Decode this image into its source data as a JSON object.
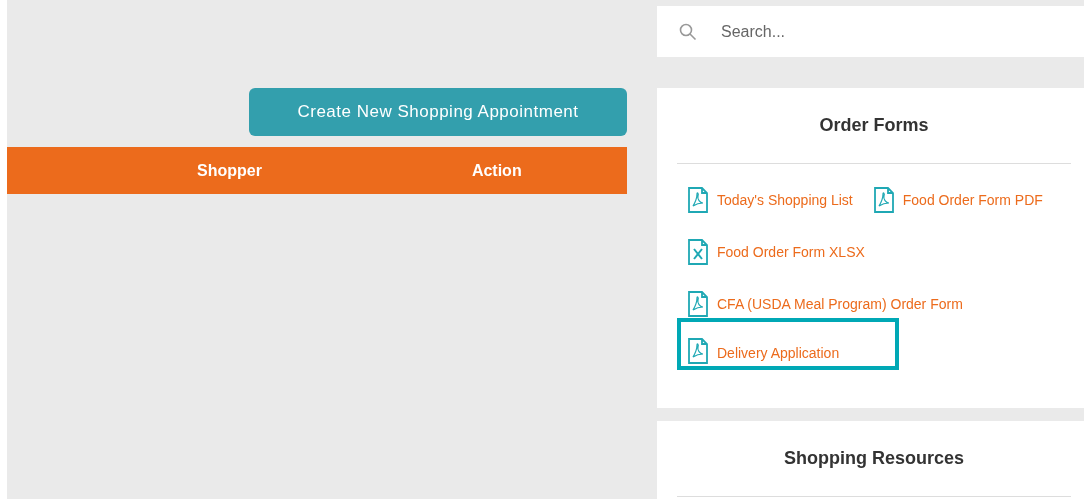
{
  "create_button": {
    "label": "Create New Shopping Appointment"
  },
  "table": {
    "columns": [
      "Shopper",
      "Action"
    ]
  },
  "search": {
    "placeholder": "Search..."
  },
  "order_forms": {
    "title": "Order Forms",
    "items": [
      {
        "label": "Today's Shopping List",
        "kind": "pdf",
        "highlighted": false
      },
      {
        "label": "Food Order Form PDF",
        "kind": "pdf",
        "highlighted": false
      },
      {
        "label": "Food Order Form XLSX",
        "kind": "xlsx",
        "highlighted": false
      },
      {
        "label": "CFA (USDA Meal Program) Order Form",
        "kind": "pdf",
        "highlighted": false
      },
      {
        "label": "Delivery Application",
        "kind": "pdf",
        "highlighted": true
      }
    ]
  },
  "shopping_resources": {
    "title": "Shopping Resources"
  }
}
